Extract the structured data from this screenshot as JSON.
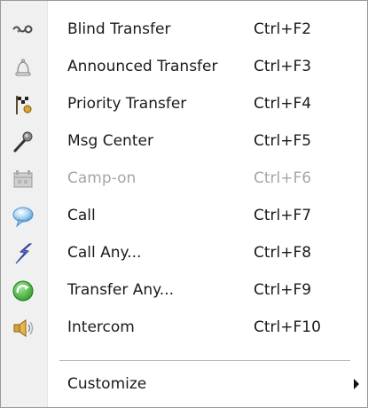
{
  "menu": {
    "items": [
      {
        "label": "Blind Transfer",
        "shortcut": "Ctrl+F2",
        "icon": "blind-transfer-icon",
        "enabled": true
      },
      {
        "label": "Announced Transfer",
        "shortcut": "Ctrl+F3",
        "icon": "bell-icon",
        "enabled": true
      },
      {
        "label": "Priority Transfer",
        "shortcut": "Ctrl+F4",
        "icon": "priority-flag-icon",
        "enabled": true
      },
      {
        "label": "Msg Center",
        "shortcut": "Ctrl+F5",
        "icon": "microphone-icon",
        "enabled": true
      },
      {
        "label": "Camp-on",
        "shortcut": "Ctrl+F6",
        "icon": "camp-on-icon",
        "enabled": false
      },
      {
        "label": "Call",
        "shortcut": "Ctrl+F7",
        "icon": "speech-bubble-icon",
        "enabled": true
      },
      {
        "label": "Call Any...",
        "shortcut": "Ctrl+F8",
        "icon": "lightning-icon",
        "enabled": true
      },
      {
        "label": "Transfer Any...",
        "shortcut": "Ctrl+F9",
        "icon": "green-arrow-icon",
        "enabled": true
      },
      {
        "label": "Intercom",
        "shortcut": "Ctrl+F10",
        "icon": "speaker-icon",
        "enabled": true
      }
    ],
    "customize": {
      "label": "Customize",
      "has_submenu": true
    }
  }
}
